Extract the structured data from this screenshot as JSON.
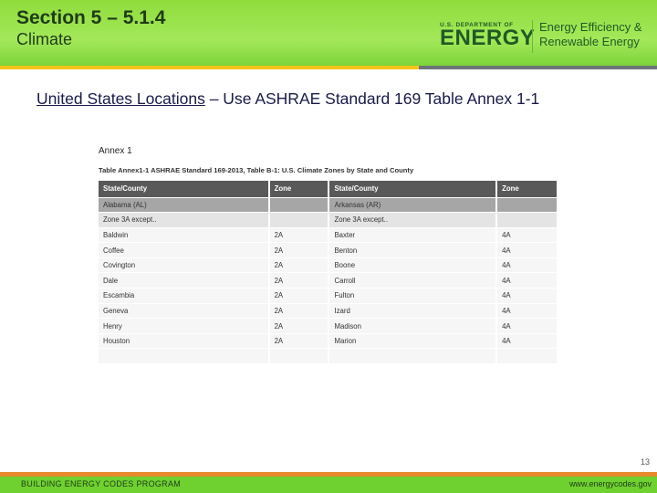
{
  "header": {
    "title": "Section 5 – 5.1.4",
    "subtitle": "Climate",
    "logo_doe_small": "U.S. DEPARTMENT OF",
    "logo_doe_big": "ENERGY",
    "logo_eere_line1": "Energy Efficiency &",
    "logo_eere_line2": "Renewable Energy"
  },
  "heading": {
    "link": "United States Locations",
    "rest": " – Use ASHRAE Standard 169 Table Annex 1-1"
  },
  "annex": {
    "label": "Annex 1",
    "caption": "Table Annex1-1  ASHRAE Standard 169-2013, Table B-1: U.S. Climate Zones by State and County",
    "columns": [
      "State/County",
      "Zone",
      "State/County",
      "Zone"
    ],
    "state_row": [
      "Alabama (AL)",
      "",
      "Arkansas (AR)",
      ""
    ],
    "note_row": [
      "Zone 3A except..",
      "",
      "Zone 3A except..",
      ""
    ],
    "rows": [
      [
        "Baldwin",
        "2A",
        "Baxter",
        "4A"
      ],
      [
        "Coffee",
        "2A",
        "Benton",
        "4A"
      ],
      [
        "Covington",
        "2A",
        "Boone",
        "4A"
      ],
      [
        "Dale",
        "2A",
        "Carroll",
        "4A"
      ],
      [
        "Escambia",
        "2A",
        "Fulton",
        "4A"
      ],
      [
        "Geneva",
        "2A",
        "Izard",
        "4A"
      ],
      [
        "Henry",
        "2A",
        "Madison",
        "4A"
      ],
      [
        "Houston",
        "2A",
        "Marion",
        "4A"
      ]
    ]
  },
  "footer": {
    "page": "13",
    "program": "BUILDING ENERGY CODES PROGRAM",
    "url": "www.energycodes.gov"
  },
  "colors": {
    "green": "#8fdc3c",
    "orange": "#e8892e",
    "yellow": "#f5c518",
    "grey": "#6d747a"
  }
}
